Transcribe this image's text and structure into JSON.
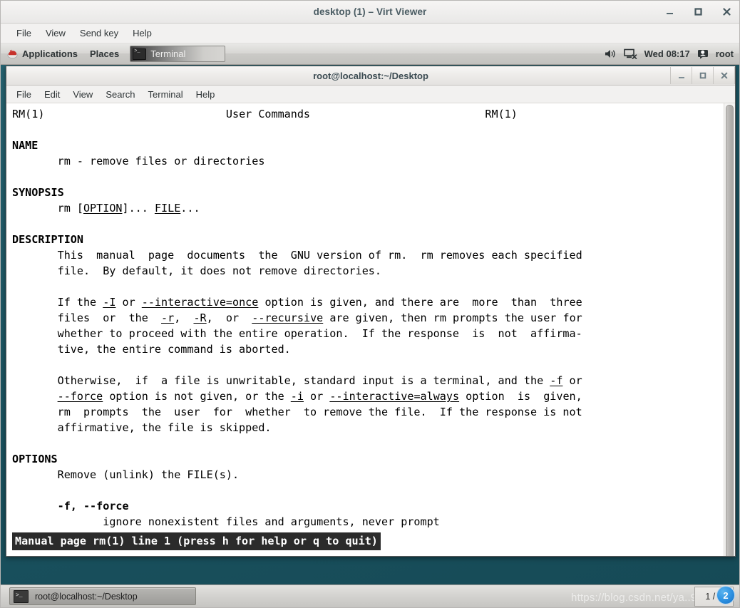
{
  "virt_viewer": {
    "title": "desktop (1) – Virt Viewer",
    "menus": [
      "File",
      "View",
      "Send key",
      "Help"
    ],
    "window_controls": {
      "minimize": "minimize-icon",
      "maximize": "maximize-icon",
      "close": "close-icon"
    }
  },
  "gnome_panel": {
    "applications_label": "Applications",
    "places_label": "Places",
    "window_button_label": "Terminal",
    "clock": "Wed 08:17",
    "user": "root",
    "icons": {
      "redhat": "redhat-logo-icon",
      "volume": "volume-icon",
      "network": "network-disconnected-icon",
      "user": "user-icon"
    }
  },
  "terminal": {
    "title": "root@localhost:~/Desktop",
    "menus": [
      "File",
      "Edit",
      "View",
      "Search",
      "Terminal",
      "Help"
    ],
    "window_controls": {
      "minimize": "minimize-icon",
      "maximize": "maximize-icon",
      "close": "close-icon"
    },
    "status_line": "Manual page rm(1) line 1 (press h for help or q to quit)",
    "man_page": {
      "header_left": "RM(1)",
      "header_center": "User Commands",
      "header_right": "RM(1)",
      "sections": [
        {
          "heading": "NAME",
          "body": "rm - remove files or directories"
        },
        {
          "heading": "SYNOPSIS",
          "body": "rm [OPTION]... FILE..."
        },
        {
          "heading": "DESCRIPTION",
          "body": "This manual page documents the GNU version of rm.  rm removes each specified file.  By default, it does not remove directories."
        },
        {
          "heading": "OPTIONS",
          "body": "Remove (unlink) the FILE(s)."
        }
      ],
      "option_entry": {
        "flags": "-f, --force",
        "description": "ignore nonexistent files and arguments, never prompt"
      },
      "lines": [
        "RM(1)                            User Commands                           RM(1)",
        "",
        "NAME",
        "       rm - remove files or directories",
        "",
        "SYNOPSIS",
        "       rm [OPTION]... FILE...",
        "",
        "DESCRIPTION",
        "       This  manual  page  documents  the  GNU version of rm.  rm removes each specified",
        "       file.  By default, it does not remove directories.",
        "",
        "       If the -I or --interactive=once option is given, and there are  more  than  three",
        "       files  or  the  -r,  -R,  or  --recursive are given, then rm prompts the user for",
        "       whether to proceed with the entire operation.  If the response  is  not  affirma-",
        "       tive, the entire command is aborted.",
        "",
        "       Otherwise,  if  a file is unwritable, standard input is a terminal, and the -f or",
        "       --force option is not given, or the -i or --interactive=always option  is  given,",
        "       rm  prompts  the  user  for  whether  to remove the file.  If the response is not",
        "       affirmative, the file is skipped.",
        "",
        "OPTIONS",
        "       Remove (unlink) the FILE(s).",
        "",
        "       -f, --force",
        "              ignore nonexistent files and arguments, never prompt"
      ]
    }
  },
  "taskbar": {
    "task_label": "root@localhost:~/Desktop",
    "task_icon": "terminal-icon",
    "workspace_indicator": "1 / 4",
    "watermark": "https://blog.csdn.net/ya..9409",
    "badge": "2"
  }
}
